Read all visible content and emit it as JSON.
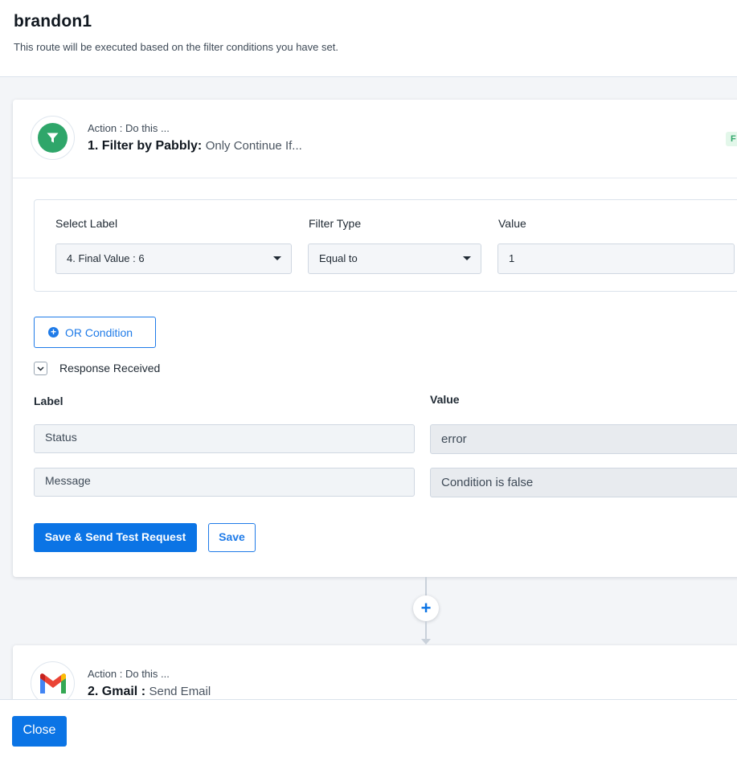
{
  "header": {
    "title": "brandon1",
    "subtitle": "This route will be executed based on the filter conditions you have set."
  },
  "step1": {
    "icon": "filter-icon",
    "caption": "Action : Do this ...",
    "title": "1. Filter by Pabbly:",
    "subtitle": "Only Continue If...",
    "status_chip": "F",
    "filter": {
      "select_label_heading": "Select Label",
      "select_label_value": "4. Final Value : 6",
      "filter_type_heading": "Filter Type",
      "filter_type_value": "Equal to",
      "value_heading": "Value",
      "value_value": "1"
    },
    "or_condition_label": "OR Condition",
    "response_toggle_label": "Response Received",
    "response": {
      "label_heading": "Label",
      "value_heading": "Value",
      "rows": [
        {
          "label": "Status",
          "value": "error"
        },
        {
          "label": "Message",
          "value": "Condition is false"
        }
      ]
    },
    "save_test_label": "Save & Send Test Request",
    "save_label": "Save"
  },
  "add_step_symbol": "+",
  "step2": {
    "icon": "gmail-icon",
    "caption": "Action : Do this ...",
    "title": "2. Gmail :",
    "subtitle": "Send Email"
  },
  "footer": {
    "close_label": "Close"
  },
  "colors": {
    "accent": "#0b74e5",
    "filter_green": "#2fa66a",
    "background": "#f3f5f8"
  }
}
